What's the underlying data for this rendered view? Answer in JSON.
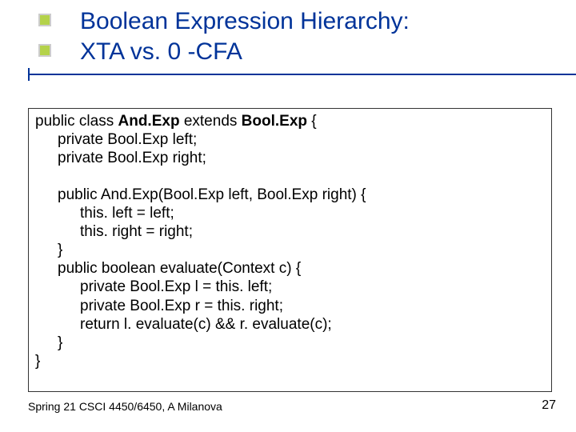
{
  "title": {
    "line1": "Boolean Expression Hierarchy:",
    "line2": "XTA vs. 0 -CFA"
  },
  "code": {
    "l1_pre": "public class ",
    "l1_cls": "And.Exp",
    "l1_mid": " extends ",
    "l1_sup": "Bool.Exp",
    "l1_end": " {",
    "l2": "private Bool.Exp left;",
    "l3": "private Bool.Exp right;",
    "l5": "public And.Exp(Bool.Exp left, Bool.Exp right) {",
    "l6": "this. left = left;",
    "l7": "this. right = right;",
    "l8": "}",
    "l9": "public boolean evaluate(Context c) {",
    "l10": "private Bool.Exp l = this. left;",
    "l11": "private Bool.Exp r = this. right;",
    "l12": "return l. evaluate(c) && r. evaluate(c);",
    "l13": "}",
    "l14": "}"
  },
  "footer": {
    "left": "Spring 21 CSCI 4450/6450, A Milanova",
    "right": "27"
  }
}
